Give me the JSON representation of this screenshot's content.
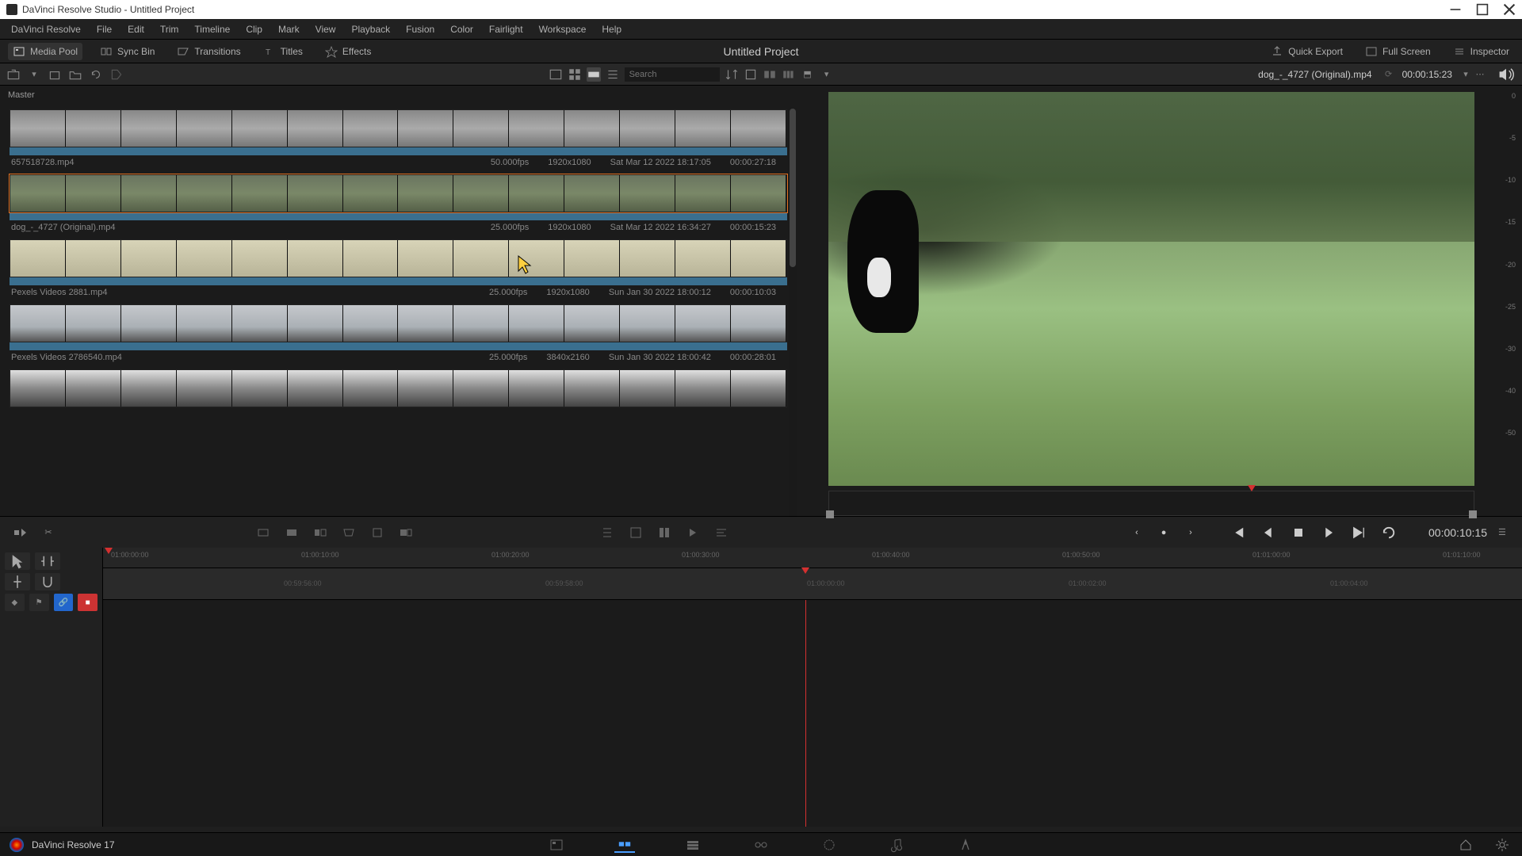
{
  "window": {
    "title": "DaVinci Resolve Studio - Untitled Project"
  },
  "menu": {
    "items": [
      "DaVinci Resolve",
      "File",
      "Edit",
      "Trim",
      "Timeline",
      "Clip",
      "Mark",
      "View",
      "Playback",
      "Fusion",
      "Color",
      "Fairlight",
      "Workspace",
      "Help"
    ]
  },
  "toolbar": {
    "media_pool": "Media Pool",
    "sync_bin": "Sync Bin",
    "transitions": "Transitions",
    "titles": "Titles",
    "effects": "Effects",
    "project_title": "Untitled Project",
    "quick_export": "Quick Export",
    "full_screen": "Full Screen",
    "inspector": "Inspector"
  },
  "search": {
    "placeholder": "Search"
  },
  "media": {
    "master": "Master",
    "clips": [
      {
        "name": "657518728.mp4",
        "fps": "50.000fps",
        "res": "1920x1080",
        "date": "Sat Mar 12 2022 18:17:05",
        "dur": "00:00:27:18",
        "style": "gray"
      },
      {
        "name": "dog_-_4727 (Original).mp4",
        "fps": "25.000fps",
        "res": "1920x1080",
        "date": "Sat Mar 12 2022 16:34:27",
        "dur": "00:00:15:23",
        "style": "green",
        "selected": true
      },
      {
        "name": "Pexels Videos 2881.mp4",
        "fps": "25.000fps",
        "res": "1920x1080",
        "date": "Sun Jan 30 2022 18:00:12",
        "dur": "00:00:10:03",
        "style": "beige"
      },
      {
        "name": "Pexels Videos 2786540.mp4",
        "fps": "25.000fps",
        "res": "3840x2160",
        "date": "Sun Jan 30 2022 18:00:42",
        "dur": "00:00:28:01",
        "style": "run"
      },
      {
        "name": "",
        "fps": "",
        "res": "",
        "date": "",
        "dur": "",
        "style": "dance"
      }
    ]
  },
  "viewer": {
    "clip_name": "dog_-_4727 (Original).mp4",
    "timecode": "00:00:15:23",
    "db_levels": [
      "0",
      "-5",
      "-10",
      "-15",
      "-20",
      "-25",
      "-30",
      "-40",
      "-50"
    ]
  },
  "transport": {
    "timecode": "00:00:10:15"
  },
  "ruler_top": [
    "01:00:00:00",
    "01:00:10:00",
    "01:00:20:00",
    "01:00:30:00",
    "01:00:40:00",
    "01:00:50:00",
    "01:01:00:00",
    "01:01:10:00"
  ],
  "ruler_mid": [
    "00:59:56:00",
    "00:59:58:00",
    "01:00:00:00",
    "01:00:02:00",
    "01:00:04:00"
  ],
  "page_bar": {
    "app": "DaVinci Resolve 17"
  }
}
